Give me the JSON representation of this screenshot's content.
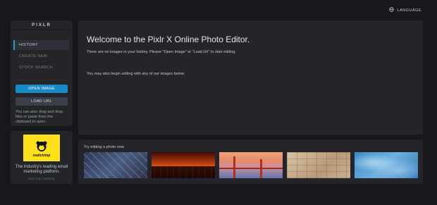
{
  "header": {
    "language_label": "LANGUAGE",
    "language_icon": "globe-icon"
  },
  "sidebar": {
    "logo": "PIXLR",
    "nav": [
      {
        "label": "HISTORY",
        "active": true
      },
      {
        "label": "CREATE NEW",
        "active": false
      },
      {
        "label": "STOCK SEARCH",
        "active": false
      }
    ],
    "open_image_label": "OPEN IMAGE",
    "load_url_label": "LOAD URL",
    "hint": "You can also drag and drop files or paste from the clipboard to open.",
    "accent_color": "#1a8ac7"
  },
  "ad": {
    "brand": "mailchimp",
    "text": "The Industry's leading email marketing platform.",
    "via": "ADS VIA CARBON"
  },
  "main": {
    "title": "Welcome to the Pixlr X Online Photo Editor.",
    "no_history": "There are no images in your history. Please \"Open Image\" or \"Load Url\" to start editing.",
    "begin_editing": "You may also begin editing with any of our images below."
  },
  "samples": {
    "title": "Try editing a photo now",
    "images": [
      "city-aerial",
      "sunset-crowd",
      "golden-gate-bridge",
      "old-pages",
      "blue-water"
    ]
  }
}
